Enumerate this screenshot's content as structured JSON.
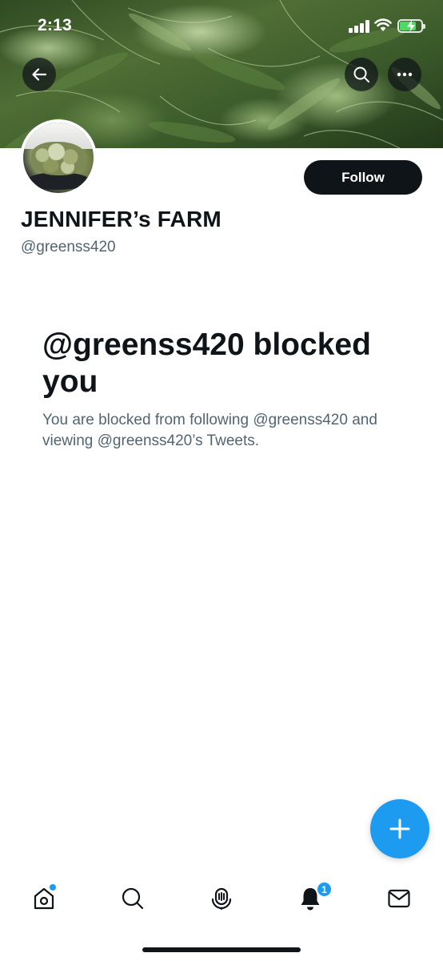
{
  "status_bar": {
    "time": "2:13"
  },
  "header": {
    "back_icon": "arrow-left-icon",
    "search_icon": "search-icon",
    "more_icon": "more-horizontal-icon"
  },
  "profile": {
    "display_name": "JENNIFER’s FARM",
    "handle": "@greenss420",
    "follow_label": "Follow"
  },
  "blocked": {
    "title": "@greenss420 blocked you",
    "description": "You are blocked from following @greenss420 and viewing @greenss420’s Tweets."
  },
  "fab": {
    "icon": "plus-icon"
  },
  "bottom_nav": {
    "items": [
      {
        "icon": "home-icon"
      },
      {
        "icon": "search-icon"
      },
      {
        "icon": "spaces-icon"
      },
      {
        "icon": "bell-icon",
        "badge": "1"
      },
      {
        "icon": "mail-icon"
      }
    ]
  },
  "colors": {
    "accent": "#1d9bf0",
    "text_primary": "#0f1419",
    "text_secondary": "#536471",
    "battery_charging": "#4cd964"
  }
}
